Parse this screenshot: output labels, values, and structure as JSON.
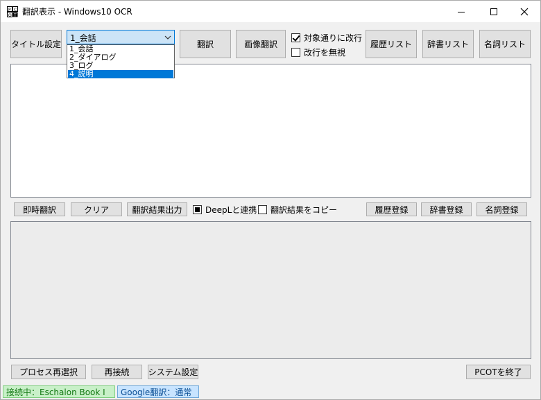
{
  "window": {
    "title": "翻訳表示 - Windows10 OCR",
    "controls": [
      "minimize-icon",
      "maximize-icon",
      "close-icon"
    ]
  },
  "toolbar": {
    "title_setting": "タイトル設定",
    "mode_select": {
      "value": "1_会話",
      "options": [
        "1_会話",
        "2_ダイアログ",
        "3_ログ",
        "4_説明"
      ],
      "highlighted": "4_説明"
    },
    "translate": "翻訳",
    "image_translate": "画像翻訳",
    "wrap_as_target": {
      "label": "対象通りに改行",
      "checked": true
    },
    "ignore_newline": {
      "label": "改行を無視",
      "checked": false
    },
    "history_list": "履歴リスト",
    "dictionary_list": "辞書リスト",
    "noun_list": "名詞リスト"
  },
  "source_text": "",
  "midbar": {
    "instant_translate": "即時翻訳",
    "clear": "クリア",
    "export_result": "翻訳結果出力",
    "deepl_link": {
      "label": "DeepLと連携",
      "checked": true
    },
    "copy_result": {
      "label": "翻訳結果をコピー",
      "checked": false
    },
    "history_register": "履歴登録",
    "dictionary_register": "辞書登録",
    "noun_register": "名詞登録"
  },
  "result_text": "",
  "bottombar": {
    "reselect_process": "プロセス再選択",
    "reconnect": "再接続",
    "system_settings": "システム設定",
    "quit": "PCOTを終了"
  },
  "statusbar": {
    "connection": "接続中：Eschalon Book I",
    "translator": "Google翻訳：通常",
    "connection_color": "#c8f0c8",
    "translator_color": "#c8e4ff"
  }
}
